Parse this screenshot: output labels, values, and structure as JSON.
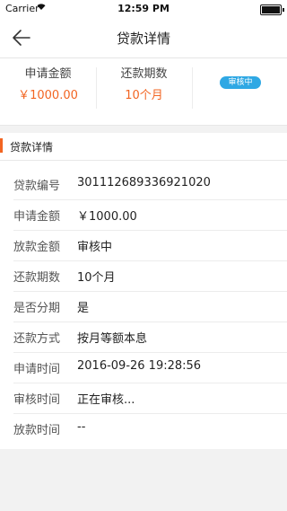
{
  "status_bar": {
    "carrier": "Carrier",
    "time": "12:59 PM"
  },
  "header": {
    "title": "贷款详情"
  },
  "summary": {
    "apply_amount_label": "申请金额",
    "apply_amount_value": "￥1000.00",
    "repay_periods_label": "还款期数",
    "repay_periods_value": "10个月",
    "status_badge": "审核中"
  },
  "section": {
    "title": "贷款详情"
  },
  "details": [
    {
      "label": "贷款编号",
      "value": "301112689336921020"
    },
    {
      "label": "申请金额",
      "value": "￥1000.00"
    },
    {
      "label": "放款金额",
      "value": "审核中"
    },
    {
      "label": "还款期数",
      "value": "10个月"
    },
    {
      "label": "是否分期",
      "value": "是"
    },
    {
      "label": "还款方式",
      "value": "按月等额本息"
    },
    {
      "label": "申请时间",
      "value": "2016-09-26 19:28:56"
    },
    {
      "label": "审核时间",
      "value": "正在审核..."
    },
    {
      "label": "放款时间",
      "value": "--"
    }
  ],
  "colors": {
    "accent": "#f26522",
    "badge": "#2fa8e4"
  }
}
